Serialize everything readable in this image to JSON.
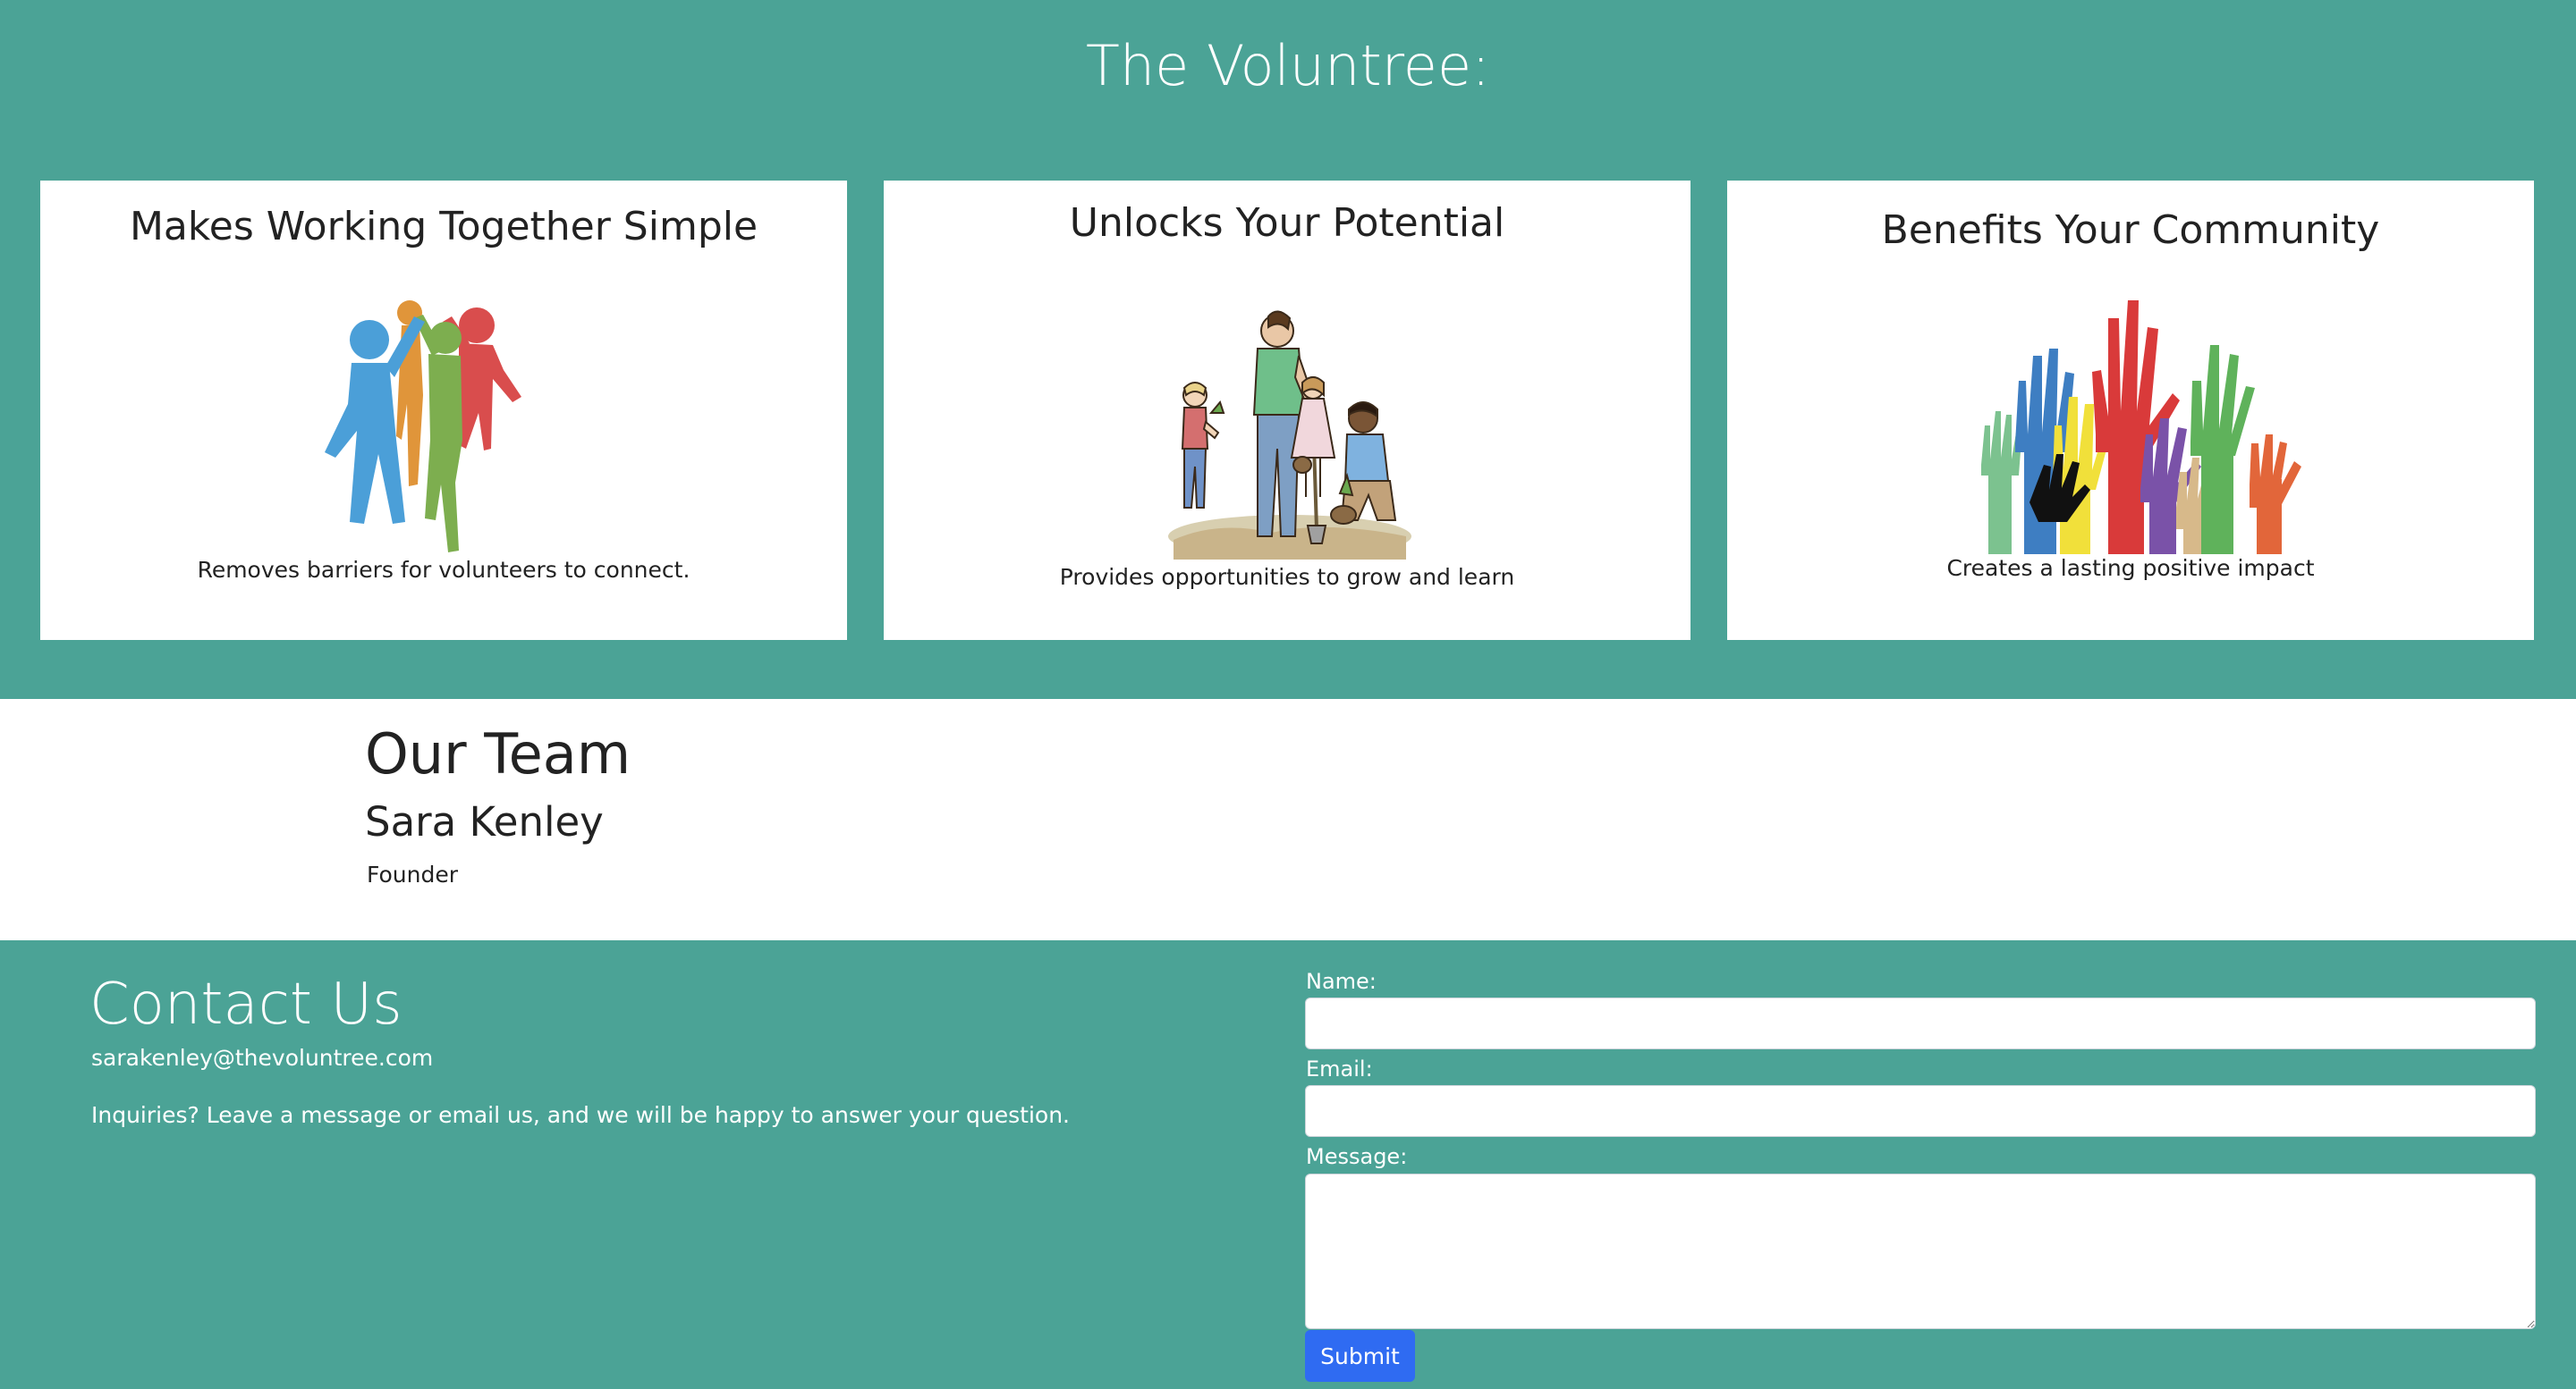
{
  "hero": {
    "title": "The Voluntree:",
    "background_color": "#4ba396",
    "cards": [
      {
        "title": "Makes Working Together Simple",
        "caption": "Removes barriers for volunteers to connect.",
        "image_icon": "people-high-five-icon"
      },
      {
        "title": "Unlocks Your Potential",
        "caption": "Provides opportunities to grow and learn",
        "image_icon": "family-planting-trees-illustration"
      },
      {
        "title": "Benefits Your Community",
        "caption": "Creates a lasting positive impact",
        "image_icon": "raised-colorful-hands-icon"
      }
    ]
  },
  "team": {
    "title": "Our Team",
    "members": [
      {
        "name": "Sara Kenley",
        "role": "Founder"
      }
    ]
  },
  "contact": {
    "title": "Contact Us",
    "email": "sarakenley@thevoluntree.com",
    "note": "Inquiries? Leave a message or email us, and we will be happy to answer your question.",
    "form": {
      "name_label": "Name:",
      "name_value": "",
      "email_label": "Email:",
      "email_value": "",
      "message_label": "Message:",
      "message_value": "",
      "submit_label": "Submit"
    },
    "accent_color": "#2f6bf2"
  }
}
